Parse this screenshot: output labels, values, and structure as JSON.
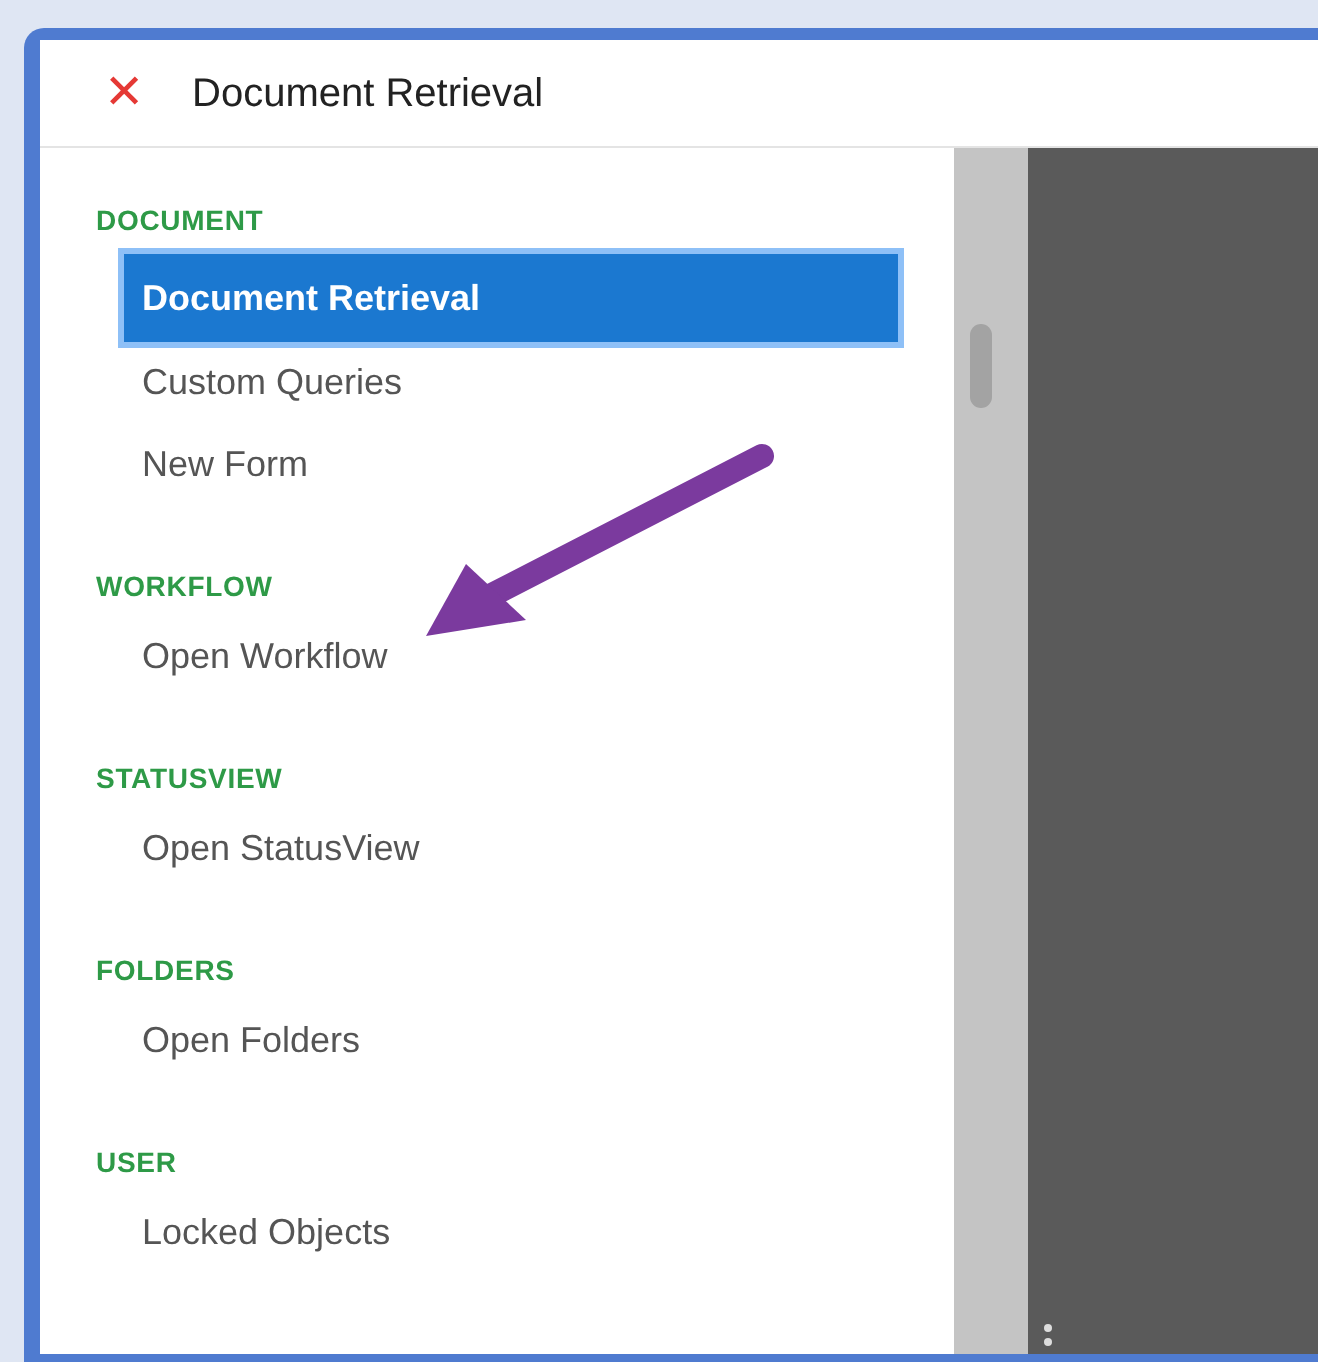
{
  "header": {
    "close_icon": "✕",
    "title": "Document Retrieval"
  },
  "sections": [
    {
      "heading": "DOCUMENT",
      "items": [
        {
          "label": "Document Retrieval",
          "selected": true
        },
        {
          "label": "Custom Queries",
          "selected": false
        },
        {
          "label": "New Form",
          "selected": false
        }
      ]
    },
    {
      "heading": "WORKFLOW",
      "items": [
        {
          "label": "Open Workflow",
          "selected": false
        }
      ]
    },
    {
      "heading": "STATUSVIEW",
      "items": [
        {
          "label": "Open StatusView",
          "selected": false
        }
      ]
    },
    {
      "heading": "FOLDERS",
      "items": [
        {
          "label": "Open Folders",
          "selected": false
        }
      ]
    },
    {
      "heading": "USER",
      "items": [
        {
          "label": "Locked Objects",
          "selected": false
        }
      ]
    }
  ]
}
